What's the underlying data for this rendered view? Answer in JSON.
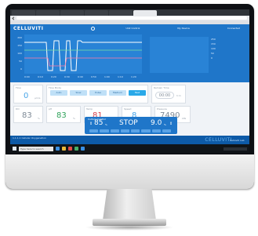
{
  "app": {
    "brand": "CELLUVITI",
    "header_right": [
      "Unit Control",
      "My Device",
      "Connected"
    ]
  },
  "chart": {
    "left_axis": [
      "200",
      "150",
      "100",
      "50",
      "0"
    ],
    "x_ticks": [
      "0:00",
      "0:10",
      "0:20",
      "0:30",
      "0:40",
      "0:50",
      "1:00",
      "1:10",
      "1:20",
      "1:30"
    ],
    "right_legend": [
      "250",
      "150",
      "100",
      "50",
      "0"
    ]
  },
  "panel": {
    "flow": {
      "label": "Flow",
      "value": "0",
      "unit": "μm/s"
    },
    "mode_label": "Flow Mode",
    "modes": [
      "Auto",
      "Slow",
      "Pulse",
      "Medium",
      "Fast"
    ],
    "mode_active": 4,
    "timer": {
      "label": "Remain Time",
      "value": "00:00",
      "unit": "h:m"
    },
    "cards": [
      {
        "label": "DO",
        "value": "83",
        "unit": "%"
      },
      {
        "label": "pH",
        "value": "83",
        "unit": "%"
      },
      {
        "label": "Temp",
        "value": "81",
        "unit": "bar.s"
      },
      {
        "label": "Speed",
        "value": "8",
        "unit": "%"
      },
      {
        "label": "Pressure",
        "value": "7490",
        "unit": "kPa"
      }
    ]
  },
  "control": {
    "title": "Culture Control",
    "left_value": "85",
    "left_unit": "%",
    "center": "STOP",
    "right_value": "9.0",
    "right_unit": "%"
  },
  "status": {
    "left": "1.1.1.1 Cellular Oxygenation",
    "logo": "CELLUVITI",
    "right": "Celluviti Lab"
  },
  "taskbar": {
    "search_placeholder": "Type here to search"
  }
}
